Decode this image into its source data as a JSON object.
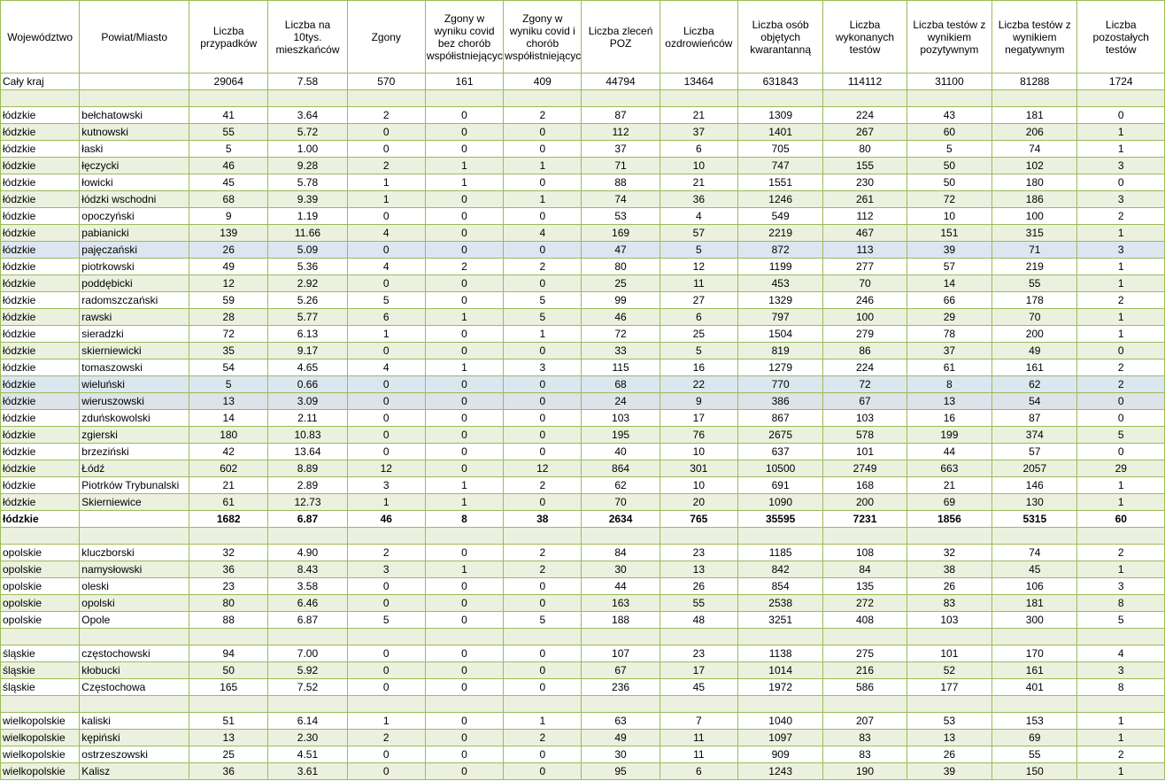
{
  "headers": [
    "Województwo",
    "Powiat/Miasto",
    "Liczba przypadków",
    "Liczba na 10tys. mieszkańców",
    "Zgony",
    "Zgony w wyniku covid bez chorób współistniejących",
    "Zgony w wyniku covid i chorób współistniejących",
    "Liczba zleceń POZ",
    "Liczba ozdrowieńców",
    "Liczba osób objętych kwarantanną",
    "Liczba wykonanych testów",
    "Liczba testów z wynikiem pozytywnym",
    "Liczba testów z wynikiem negatywnym",
    "Liczba pozostałych testów"
  ],
  "rows": [
    {
      "type": "data",
      "cells": [
        "Cały kraj",
        "",
        "29064",
        "7.58",
        "570",
        "161",
        "409",
        "44794",
        "13464",
        "631843",
        "114112",
        "31100",
        "81288",
        "1724"
      ]
    },
    {
      "type": "blank",
      "cells": [
        "",
        "",
        "",
        "",
        "",
        "",
        "",
        "",
        "",
        "",
        "",
        "",
        "",
        ""
      ]
    },
    {
      "type": "data",
      "cells": [
        "łódzkie",
        "bełchatowski",
        "41",
        "3.64",
        "2",
        "0",
        "2",
        "87",
        "21",
        "1309",
        "224",
        "43",
        "181",
        "0"
      ]
    },
    {
      "type": "data",
      "cells": [
        "łódzkie",
        "kutnowski",
        "55",
        "5.72",
        "0",
        "0",
        "0",
        "112",
        "37",
        "1401",
        "267",
        "60",
        "206",
        "1"
      ]
    },
    {
      "type": "data",
      "cells": [
        "łódzkie",
        "łaski",
        "5",
        "1.00",
        "0",
        "0",
        "0",
        "37",
        "6",
        "705",
        "80",
        "5",
        "74",
        "1"
      ]
    },
    {
      "type": "data",
      "cells": [
        "łódzkie",
        "łęczycki",
        "46",
        "9.28",
        "2",
        "1",
        "1",
        "71",
        "10",
        "747",
        "155",
        "50",
        "102",
        "3"
      ]
    },
    {
      "type": "data",
      "cells": [
        "łódzkie",
        "łowicki",
        "45",
        "5.78",
        "1",
        "1",
        "0",
        "88",
        "21",
        "1551",
        "230",
        "50",
        "180",
        "0"
      ]
    },
    {
      "type": "data",
      "cells": [
        "łódzkie",
        "łódzki wschodni",
        "68",
        "9.39",
        "1",
        "0",
        "1",
        "74",
        "36",
        "1246",
        "261",
        "72",
        "186",
        "3"
      ]
    },
    {
      "type": "data",
      "cells": [
        "łódzkie",
        "opoczyński",
        "9",
        "1.19",
        "0",
        "0",
        "0",
        "53",
        "4",
        "549",
        "112",
        "10",
        "100",
        "2"
      ]
    },
    {
      "type": "data",
      "cells": [
        "łódzkie",
        "pabianicki",
        "139",
        "11.66",
        "4",
        "0",
        "4",
        "169",
        "57",
        "2219",
        "467",
        "151",
        "315",
        "1"
      ]
    },
    {
      "type": "data",
      "hl": "blue",
      "cells": [
        "łódzkie",
        "pajęczański",
        "26",
        "5.09",
        "0",
        "0",
        "0",
        "47",
        "5",
        "872",
        "113",
        "39",
        "71",
        "3"
      ]
    },
    {
      "type": "data",
      "cells": [
        "łódzkie",
        "piotrkowski",
        "49",
        "5.36",
        "4",
        "2",
        "2",
        "80",
        "12",
        "1199",
        "277",
        "57",
        "219",
        "1"
      ]
    },
    {
      "type": "data",
      "cells": [
        "łódzkie",
        "poddębicki",
        "12",
        "2.92",
        "0",
        "0",
        "0",
        "25",
        "11",
        "453",
        "70",
        "14",
        "55",
        "1"
      ]
    },
    {
      "type": "data",
      "cells": [
        "łódzkie",
        "radomszczański",
        "59",
        "5.26",
        "5",
        "0",
        "5",
        "99",
        "27",
        "1329",
        "246",
        "66",
        "178",
        "2"
      ]
    },
    {
      "type": "data",
      "cells": [
        "łódzkie",
        "rawski",
        "28",
        "5.77",
        "6",
        "1",
        "5",
        "46",
        "6",
        "797",
        "100",
        "29",
        "70",
        "1"
      ]
    },
    {
      "type": "data",
      "cells": [
        "łódzkie",
        "sieradzki",
        "72",
        "6.13",
        "1",
        "0",
        "1",
        "72",
        "25",
        "1504",
        "279",
        "78",
        "200",
        "1"
      ]
    },
    {
      "type": "data",
      "cells": [
        "łódzkie",
        "skierniewicki",
        "35",
        "9.17",
        "0",
        "0",
        "0",
        "33",
        "5",
        "819",
        "86",
        "37",
        "49",
        "0"
      ]
    },
    {
      "type": "data",
      "cells": [
        "łódzkie",
        "tomaszowski",
        "54",
        "4.65",
        "4",
        "1",
        "3",
        "115",
        "16",
        "1279",
        "224",
        "61",
        "161",
        "2"
      ]
    },
    {
      "type": "data",
      "hl": "blue",
      "cells": [
        "łódzkie",
        "wieluński",
        "5",
        "0.66",
        "0",
        "0",
        "0",
        "68",
        "22",
        "770",
        "72",
        "8",
        "62",
        "2"
      ]
    },
    {
      "type": "data",
      "hl": "gray",
      "cells": [
        "łódzkie",
        "wieruszowski",
        "13",
        "3.09",
        "0",
        "0",
        "0",
        "24",
        "9",
        "386",
        "67",
        "13",
        "54",
        "0"
      ]
    },
    {
      "type": "data",
      "cells": [
        "łódzkie",
        "zduńskowolski",
        "14",
        "2.11",
        "0",
        "0",
        "0",
        "103",
        "17",
        "867",
        "103",
        "16",
        "87",
        "0"
      ]
    },
    {
      "type": "data",
      "cells": [
        "łódzkie",
        "zgierski",
        "180",
        "10.83",
        "0",
        "0",
        "0",
        "195",
        "76",
        "2675",
        "578",
        "199",
        "374",
        "5"
      ]
    },
    {
      "type": "data",
      "cells": [
        "łódzkie",
        "brzeziński",
        "42",
        "13.64",
        "0",
        "0",
        "0",
        "40",
        "10",
        "637",
        "101",
        "44",
        "57",
        "0"
      ]
    },
    {
      "type": "data",
      "cells": [
        "łódzkie",
        "Łódź",
        "602",
        "8.89",
        "12",
        "0",
        "12",
        "864",
        "301",
        "10500",
        "2749",
        "663",
        "2057",
        "29"
      ]
    },
    {
      "type": "data",
      "cells": [
        "łódzkie",
        "Piotrków Trybunalski",
        "21",
        "2.89",
        "3",
        "1",
        "2",
        "62",
        "10",
        "691",
        "168",
        "21",
        "146",
        "1"
      ]
    },
    {
      "type": "data",
      "cells": [
        "łódzkie",
        "Skierniewice",
        "61",
        "12.73",
        "1",
        "1",
        "0",
        "70",
        "20",
        "1090",
        "200",
        "69",
        "130",
        "1"
      ]
    },
    {
      "type": "total",
      "cells": [
        "łódzkie",
        "",
        "1682",
        "6.87",
        "46",
        "8",
        "38",
        "2634",
        "765",
        "35595",
        "7231",
        "1856",
        "5315",
        "60"
      ]
    },
    {
      "type": "blank",
      "cells": [
        "",
        "",
        "",
        "",
        "",
        "",
        "",
        "",
        "",
        "",
        "",
        "",
        "",
        ""
      ]
    },
    {
      "type": "data",
      "cells": [
        "opolskie",
        "kluczborski",
        "32",
        "4.90",
        "2",
        "0",
        "2",
        "84",
        "23",
        "1185",
        "108",
        "32",
        "74",
        "2"
      ]
    },
    {
      "type": "data",
      "cells": [
        "opolskie",
        "namysłowski",
        "36",
        "8.43",
        "3",
        "1",
        "2",
        "30",
        "13",
        "842",
        "84",
        "38",
        "45",
        "1"
      ]
    },
    {
      "type": "data",
      "cells": [
        "opolskie",
        "oleski",
        "23",
        "3.58",
        "0",
        "0",
        "0",
        "44",
        "26",
        "854",
        "135",
        "26",
        "106",
        "3"
      ]
    },
    {
      "type": "data",
      "cells": [
        "opolskie",
        "opolski",
        "80",
        "6.46",
        "0",
        "0",
        "0",
        "163",
        "55",
        "2538",
        "272",
        "83",
        "181",
        "8"
      ]
    },
    {
      "type": "data",
      "cells": [
        "opolskie",
        "Opole",
        "88",
        "6.87",
        "5",
        "0",
        "5",
        "188",
        "48",
        "3251",
        "408",
        "103",
        "300",
        "5"
      ]
    },
    {
      "type": "blank",
      "cells": [
        "",
        "",
        "",
        "",
        "",
        "",
        "",
        "",
        "",
        "",
        "",
        "",
        "",
        ""
      ]
    },
    {
      "type": "data",
      "cells": [
        "śląskie",
        "częstochowski",
        "94",
        "7.00",
        "0",
        "0",
        "0",
        "107",
        "23",
        "1138",
        "275",
        "101",
        "170",
        "4"
      ]
    },
    {
      "type": "data",
      "cells": [
        "śląskie",
        "kłobucki",
        "50",
        "5.92",
        "0",
        "0",
        "0",
        "67",
        "17",
        "1014",
        "216",
        "52",
        "161",
        "3"
      ]
    },
    {
      "type": "data",
      "cells": [
        "śląskie",
        "Częstochowa",
        "165",
        "7.52",
        "0",
        "0",
        "0",
        "236",
        "45",
        "1972",
        "586",
        "177",
        "401",
        "8"
      ]
    },
    {
      "type": "blank",
      "cells": [
        "",
        "",
        "",
        "",
        "",
        "",
        "",
        "",
        "",
        "",
        "",
        "",
        "",
        ""
      ]
    },
    {
      "type": "data",
      "cells": [
        "wielkopolskie",
        "kaliski",
        "51",
        "6.14",
        "1",
        "0",
        "1",
        "63",
        "7",
        "1040",
        "207",
        "53",
        "153",
        "1"
      ]
    },
    {
      "type": "data",
      "cells": [
        "wielkopolskie",
        "kępiński",
        "13",
        "2.30",
        "2",
        "0",
        "2",
        "49",
        "11",
        "1097",
        "83",
        "13",
        "69",
        "1"
      ]
    },
    {
      "type": "data",
      "cells": [
        "wielkopolskie",
        "ostrzeszowski",
        "25",
        "4.51",
        "0",
        "0",
        "0",
        "30",
        "11",
        "909",
        "83",
        "26",
        "55",
        "2"
      ]
    },
    {
      "type": "data",
      "cells": [
        "wielkopolskie",
        "Kalisz",
        "36",
        "3.61",
        "0",
        "0",
        "0",
        "95",
        "6",
        "1243",
        "190",
        "39",
        "150",
        "1"
      ]
    }
  ]
}
